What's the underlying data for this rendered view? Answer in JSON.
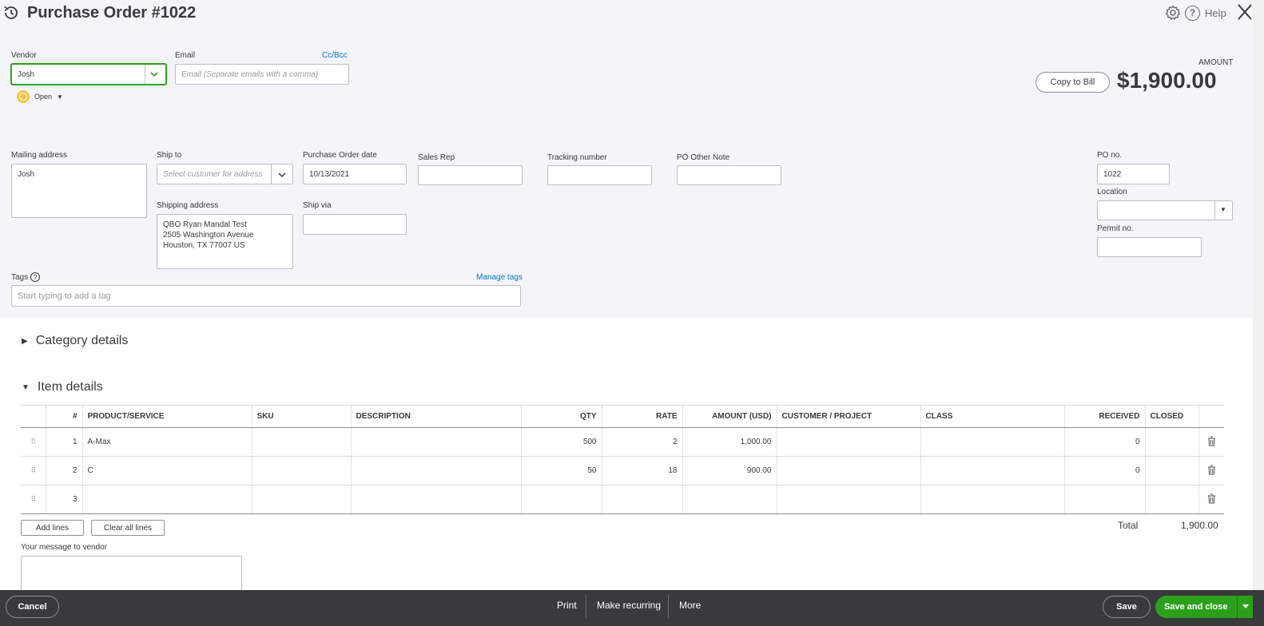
{
  "header": {
    "title": "Purchase Order #1022",
    "help_label": "Help"
  },
  "vendor": {
    "label": "Vendor",
    "value": "Josh"
  },
  "email": {
    "label": "Email",
    "placeholder": "Email (Separate emails with a comma)",
    "ccbcc": "Cc/Bcc"
  },
  "status": {
    "label": "Open"
  },
  "amount": {
    "label": "AMOUNT",
    "value": "$1,900.00",
    "copy_to_bill": "Copy to Bill"
  },
  "mailing_address": {
    "label": "Mailing address",
    "value": "Josh"
  },
  "ship_to": {
    "label": "Ship to",
    "placeholder": "Select customer for address"
  },
  "shipping_address": {
    "label": "Shipping address",
    "line1": "QBO Ryan Mandal Test",
    "line2": "2505 Washington Avenue",
    "line3": "Houston, TX  77007 US"
  },
  "po_date": {
    "label": "Purchase Order date",
    "value": "10/13/2021"
  },
  "ship_via": {
    "label": "Ship via",
    "value": ""
  },
  "sales_rep": {
    "label": "Sales Rep",
    "value": ""
  },
  "tracking": {
    "label": "Tracking number",
    "value": ""
  },
  "po_note": {
    "label": "PO Other Note",
    "value": ""
  },
  "po_no": {
    "label": "PO no.",
    "value": "1022"
  },
  "location": {
    "label": "Location",
    "value": ""
  },
  "permit": {
    "label": "Permit no.",
    "value": ""
  },
  "tags": {
    "label": "Tags",
    "placeholder": "Start typing to add a tag",
    "manage": "Manage tags"
  },
  "category_details": {
    "label": "Category details"
  },
  "item_details": {
    "label": "Item details",
    "columns": [
      "#",
      "PRODUCT/SERVICE",
      "SKU",
      "DESCRIPTION",
      "QTY",
      "RATE",
      "AMOUNT (USD)",
      "CUSTOMER / PROJECT",
      "CLASS",
      "RECEIVED",
      "CLOSED"
    ],
    "rows": [
      {
        "num": "1",
        "product": "A-Max",
        "sku": "",
        "description": "",
        "qty": "500",
        "rate": "2",
        "amount": "1,000.00",
        "customer": "",
        "class": "",
        "received": "0",
        "closed": ""
      },
      {
        "num": "2",
        "product": "C",
        "sku": "",
        "description": "",
        "qty": "50",
        "rate": "18",
        "amount": "900.00",
        "customer": "",
        "class": "",
        "received": "0",
        "closed": ""
      },
      {
        "num": "3",
        "product": "",
        "sku": "",
        "description": "",
        "qty": "",
        "rate": "",
        "amount": "",
        "customer": "",
        "class": "",
        "received": "",
        "closed": ""
      }
    ],
    "add_lines": "Add lines",
    "clear_lines": "Clear all lines",
    "total_label": "Total",
    "total_value": "1,900.00"
  },
  "message": {
    "label": "Your message to vendor",
    "value": ""
  },
  "footer": {
    "cancel": "Cancel",
    "print": "Print",
    "make_recurring": "Make recurring",
    "more": "More",
    "save": "Save",
    "save_close": "Save and close"
  },
  "colors": {
    "brand_green": "#2ca01c",
    "link_blue": "#0077c5",
    "footer_bg": "#393a3d",
    "status_yellow": "#f3c64a"
  }
}
